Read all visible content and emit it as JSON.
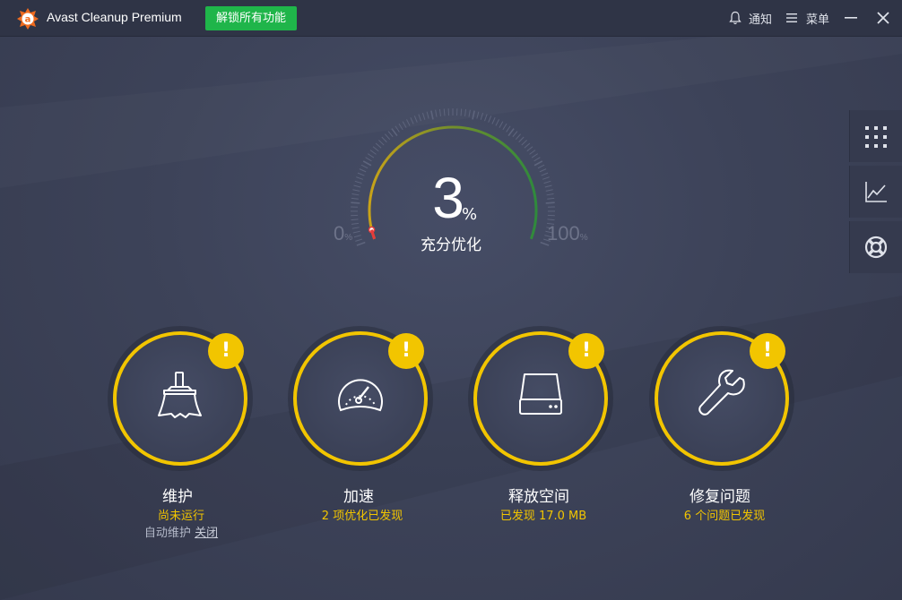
{
  "app": {
    "title": "Avast Cleanup Premium",
    "unlock_label": "解锁所有功能",
    "notify_label": "通知",
    "menu_label": "菜单"
  },
  "gauge": {
    "value": 3,
    "value_text": "3",
    "unit": "%",
    "status": "充分优化",
    "min_label": "0",
    "max_label": "100",
    "min_unit": "%",
    "max_unit": "%"
  },
  "side_panel": {
    "items": [
      "grid-icon",
      "chart-icon",
      "lifebuoy-icon"
    ]
  },
  "cards": [
    {
      "icon": "broom-icon",
      "title": "维护",
      "subtitle": "尚未运行",
      "extra_text": "自动维护",
      "extra_link": "关闭",
      "badge": "!"
    },
    {
      "icon": "speedometer-icon",
      "title": "加速",
      "subtitle": "2 项优化已发现",
      "badge": "!"
    },
    {
      "icon": "disk-icon",
      "title": "释放空间",
      "subtitle": "已发现 17.0 MB",
      "badge": "!"
    },
    {
      "icon": "wrench-icon",
      "title": "修复问题",
      "subtitle": "6 个问题已发现",
      "badge": "!"
    }
  ],
  "colors": {
    "accent_yellow": "#f2c500",
    "unlock_green": "#1fb54a",
    "background": "#3c4257",
    "titlebar": "#2f3446",
    "logo_orange": "#f06b1f"
  }
}
